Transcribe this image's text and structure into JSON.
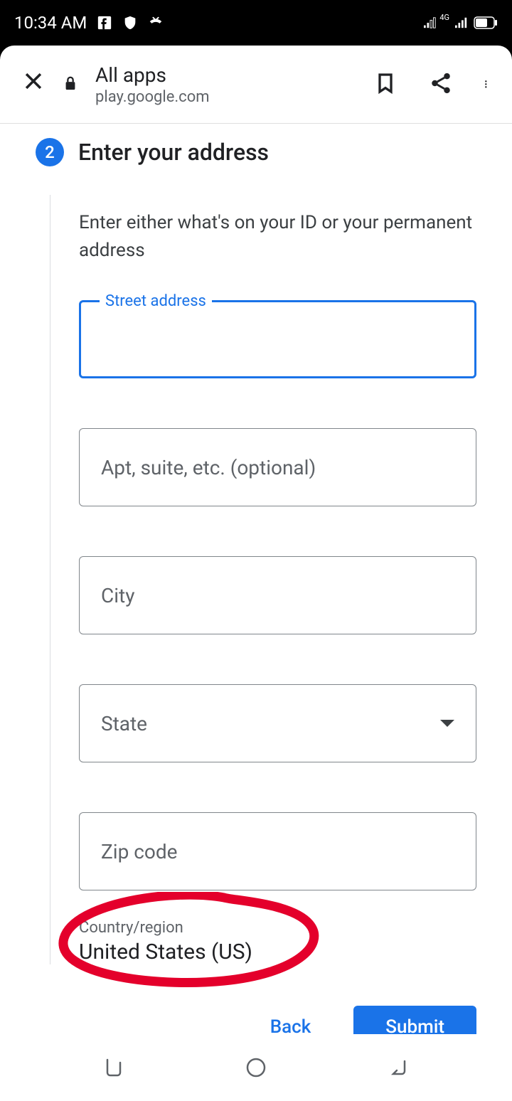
{
  "status_bar": {
    "time": "10:34 AM",
    "network_label": "4G"
  },
  "browser": {
    "title": "All apps",
    "url": "play.google.com"
  },
  "step": {
    "number": "2",
    "title": "Enter your address"
  },
  "instruction": "Enter either what's on your ID or your permanent address",
  "fields": {
    "street_label": "Street address",
    "apt_placeholder": "Apt, suite, etc. (optional)",
    "city_placeholder": "City",
    "state_placeholder": "State",
    "zip_placeholder": "Zip code"
  },
  "country": {
    "label": "Country/region",
    "value": "United States (US)"
  },
  "buttons": {
    "back": "Back",
    "submit": "Submit"
  }
}
